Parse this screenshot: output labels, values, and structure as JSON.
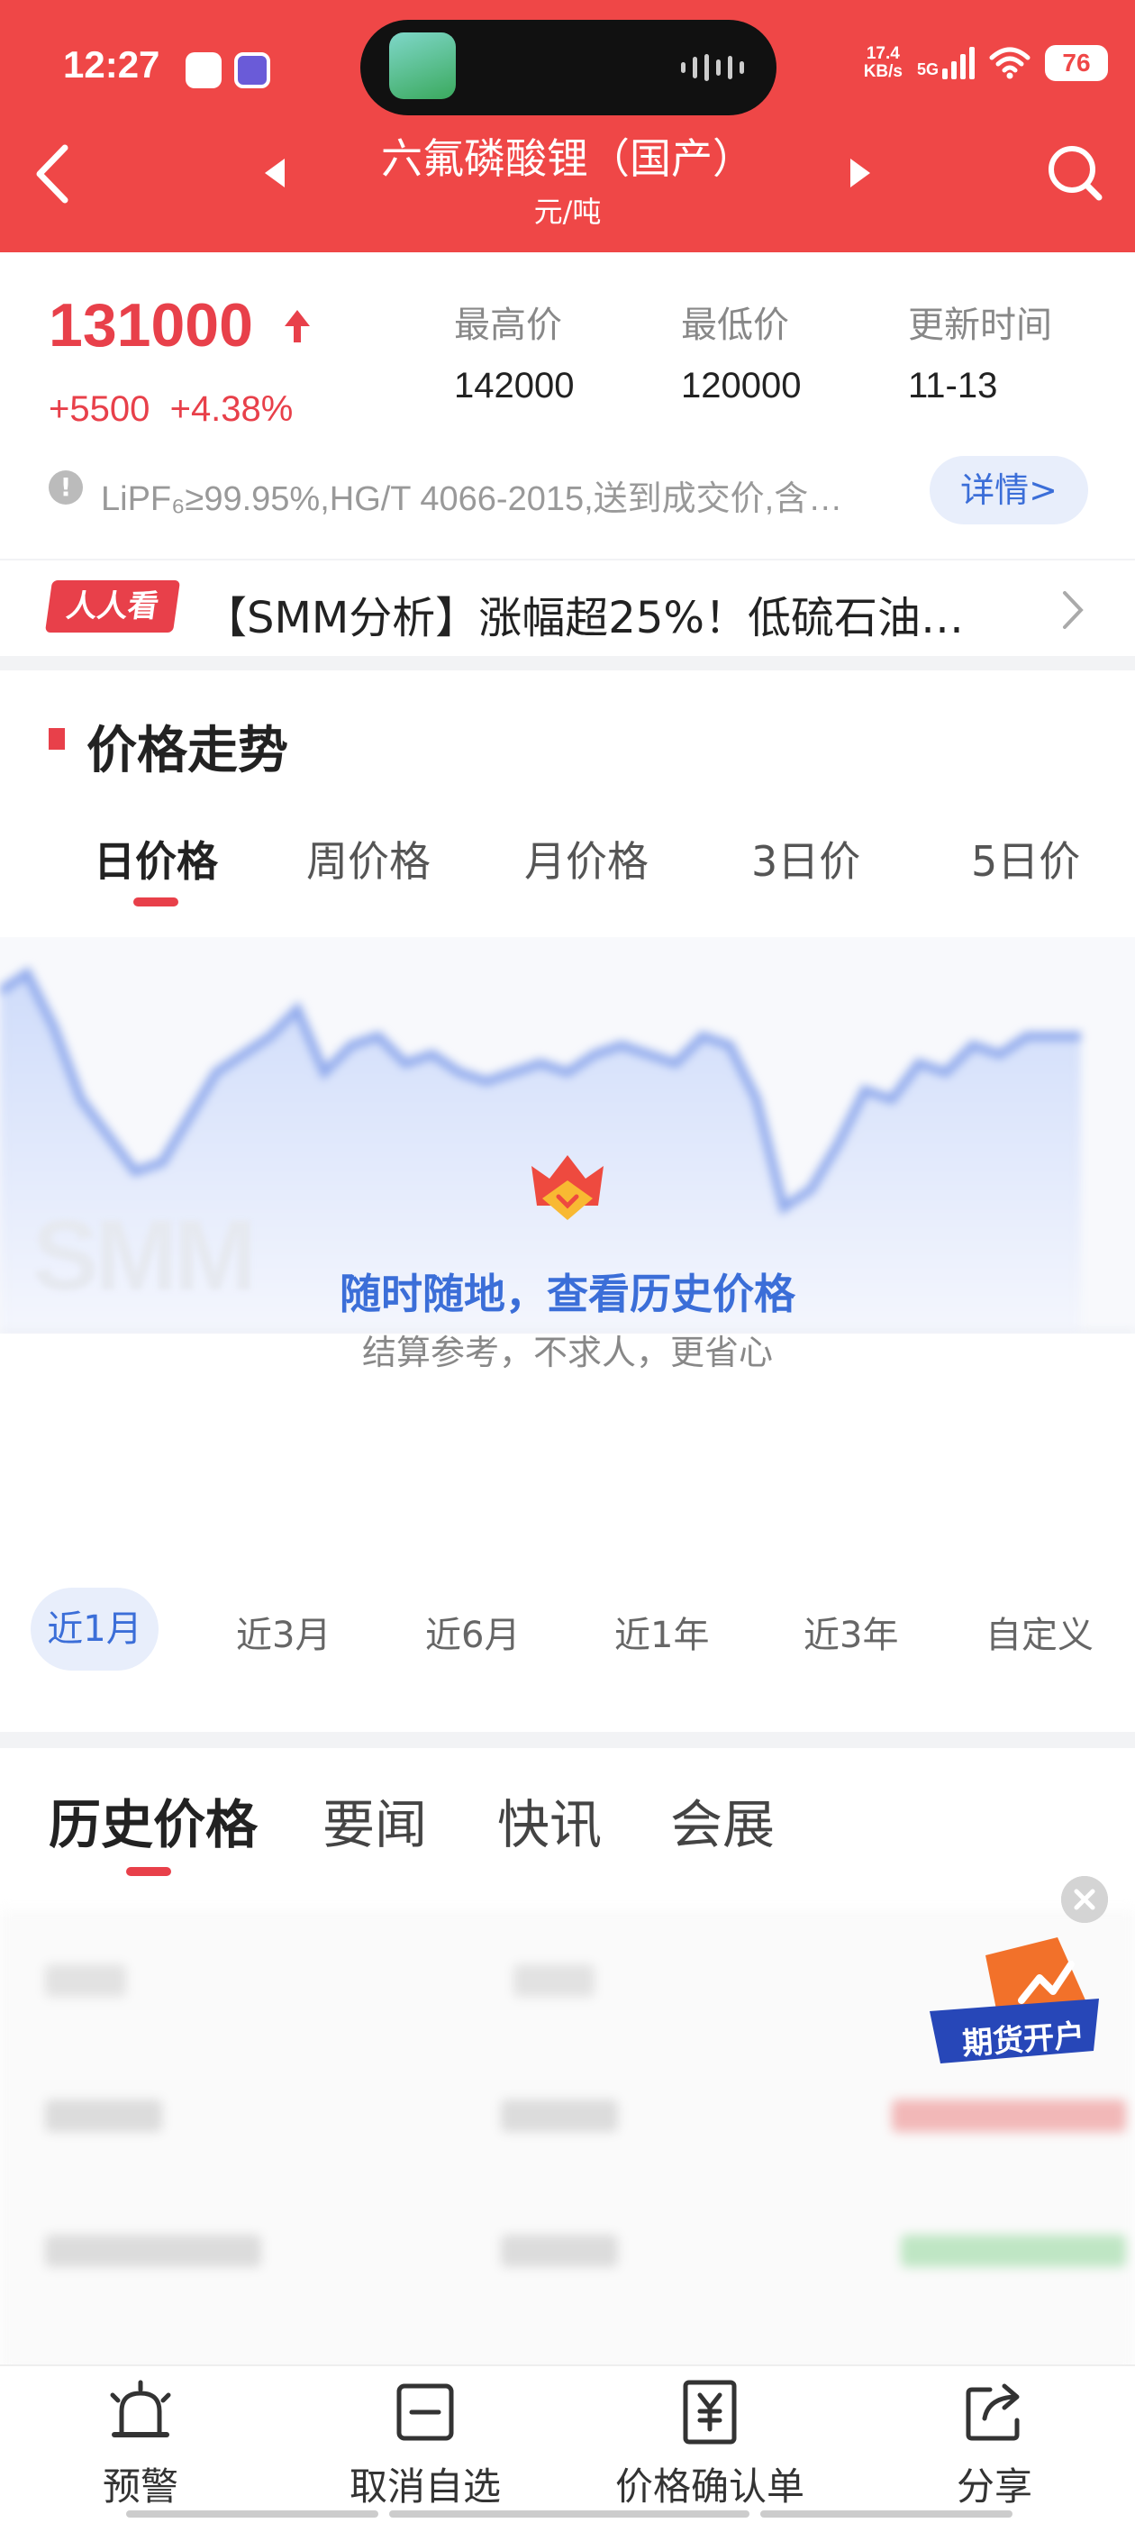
{
  "status_bar": {
    "time": "12:27",
    "net_speed_value": "17.4",
    "net_speed_unit": "KB/s",
    "network": "5G",
    "battery": "76"
  },
  "header": {
    "title": "六氟磷酸锂（国产）",
    "unit": "元/吨",
    "bg_color": "#ef4747"
  },
  "price": {
    "current": "131000",
    "change_abs": "+5500",
    "change_pct": "+4.38%",
    "stats": [
      {
        "label": "最高价",
        "value": "142000"
      },
      {
        "label": "最低价",
        "value": "120000"
      },
      {
        "label": "更新时间",
        "value": "11-13"
      }
    ],
    "note": "LiPF₆≥99.95%,HG/T 4066-2015,送到成交价,含…",
    "detail_button": "详情>"
  },
  "ticker": {
    "badge": "人人看",
    "text": "【SMM分析】涨幅超25%！低硫石油…"
  },
  "trend": {
    "title": "价格走势",
    "tabs": [
      "日价格",
      "周价格",
      "月价格",
      "3日价",
      "5日价"
    ],
    "active_tab": 0,
    "watermark": "SMM",
    "promo_title": "随时随地，查看历史价格",
    "promo_subtitle": "结算参考，不求人，更省心",
    "ranges": [
      "近1月",
      "近3月",
      "近6月",
      "近1年",
      "近3年",
      "自定义"
    ],
    "active_range": 0
  },
  "history": {
    "tabs": [
      "历史价格",
      "要闻",
      "快讯",
      "会展"
    ],
    "active_tab": 0,
    "futures_badge": "期货开户"
  },
  "bottom_bar": {
    "items": [
      {
        "label": "预警",
        "icon": "alarm-icon"
      },
      {
        "label": "取消自选",
        "icon": "minus-box-icon"
      },
      {
        "label": "价格确认单",
        "icon": "yuan-receipt-icon"
      },
      {
        "label": "分享",
        "icon": "share-icon"
      }
    ]
  },
  "colors": {
    "accent_red": "#e8404a",
    "link_blue": "#3b6ed8"
  }
}
